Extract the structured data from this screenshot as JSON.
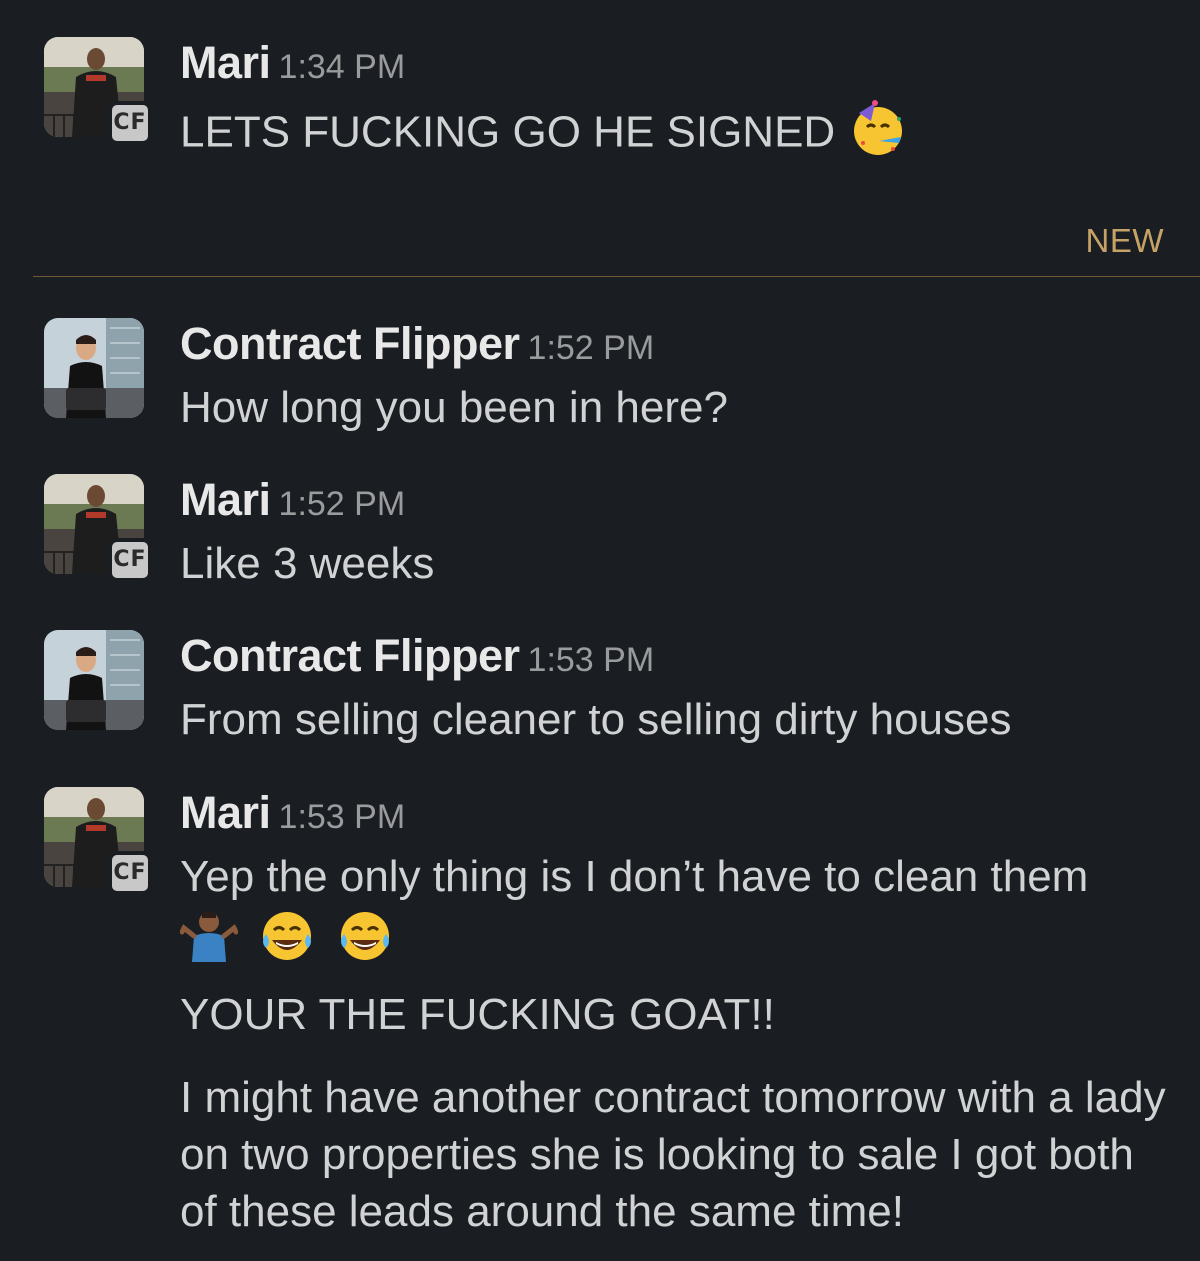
{
  "divider": {
    "label": "NEW",
    "color": "#c5a266"
  },
  "badge_text": "CF",
  "messages": [
    {
      "author": "Mari",
      "time": "1:34 PM",
      "avatar": "mari-avatar",
      "lines": [
        "LETS FUCKING GO HE SIGNED"
      ],
      "emoji": [
        "partying-face-icon"
      ]
    },
    {
      "author": "Contract Flipper",
      "time": "1:52 PM",
      "avatar": "contract-flipper-avatar",
      "lines": [
        "How long you been in here?"
      ]
    },
    {
      "author": "Mari",
      "time": "1:52 PM",
      "avatar": "mari-avatar",
      "lines": [
        "Like 3 weeks"
      ]
    },
    {
      "author": "Contract Flipper",
      "time": "1:53 PM",
      "avatar": "contract-flipper-avatar",
      "lines": [
        "From selling cleaner to selling dirty houses"
      ]
    },
    {
      "author": "Mari",
      "time": "1:53 PM",
      "avatar": "mari-avatar",
      "lines": [
        "Yep the only thing is I don’t have to clean them",
        "YOUR THE FUCKING GOAT!!",
        "I might have another contract tomorrow with a lady on two properties she is looking to sale I got both of these leads around the same time!"
      ],
      "emoji": [
        "person-shrugging-icon",
        "tears-of-joy-icon",
        "tears-of-joy-icon"
      ]
    }
  ]
}
